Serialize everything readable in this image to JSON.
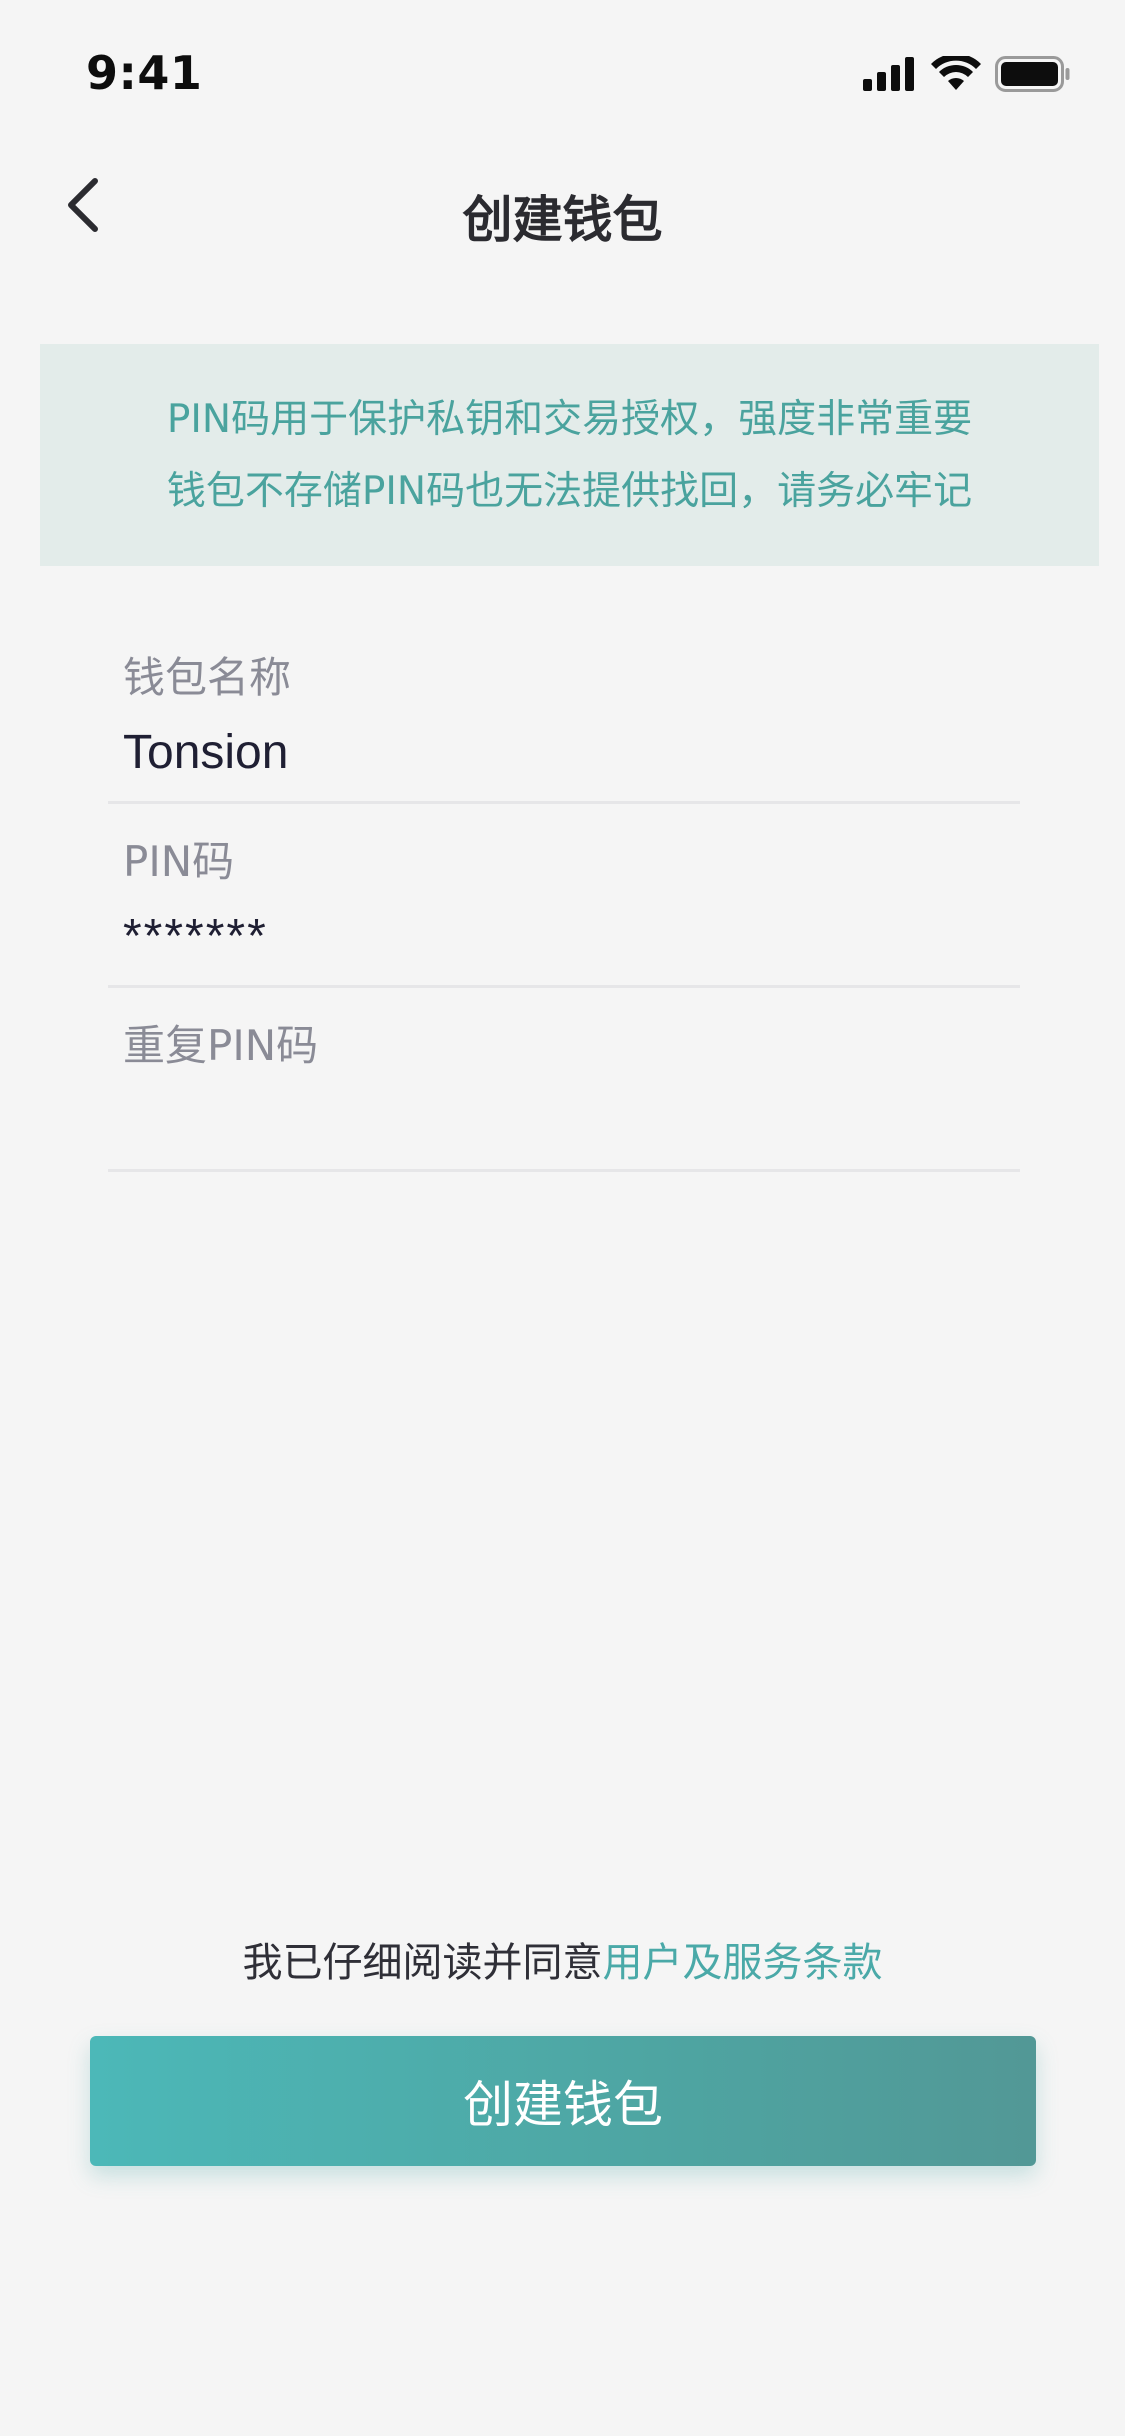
{
  "status_bar": {
    "time": "9:41"
  },
  "nav": {
    "title": "创建钱包"
  },
  "notice": {
    "line1": "PIN码用于保护私钥和交易授权，强度非常重要",
    "line2": "钱包不存储PIN码也无法提供找回，请务必牢记"
  },
  "form": {
    "wallet_name": {
      "label": "钱包名称",
      "value": "Tonsion"
    },
    "pin": {
      "label": "PIN码",
      "value": "*******"
    },
    "repeat_pin": {
      "label": "重复PIN码",
      "value": ""
    }
  },
  "terms": {
    "prefix": "我已仔细阅读并同意",
    "link": "用户及服务条款"
  },
  "actions": {
    "create_label": "创建钱包"
  },
  "colors": {
    "accent": "#4aa9a8",
    "notice_bg": "#e3ecea",
    "background": "#f5f5f5"
  },
  "icons": {
    "back": "chevron-left-icon",
    "signal": "cellular-signal-icon",
    "wifi": "wifi-icon",
    "battery": "battery-icon"
  }
}
